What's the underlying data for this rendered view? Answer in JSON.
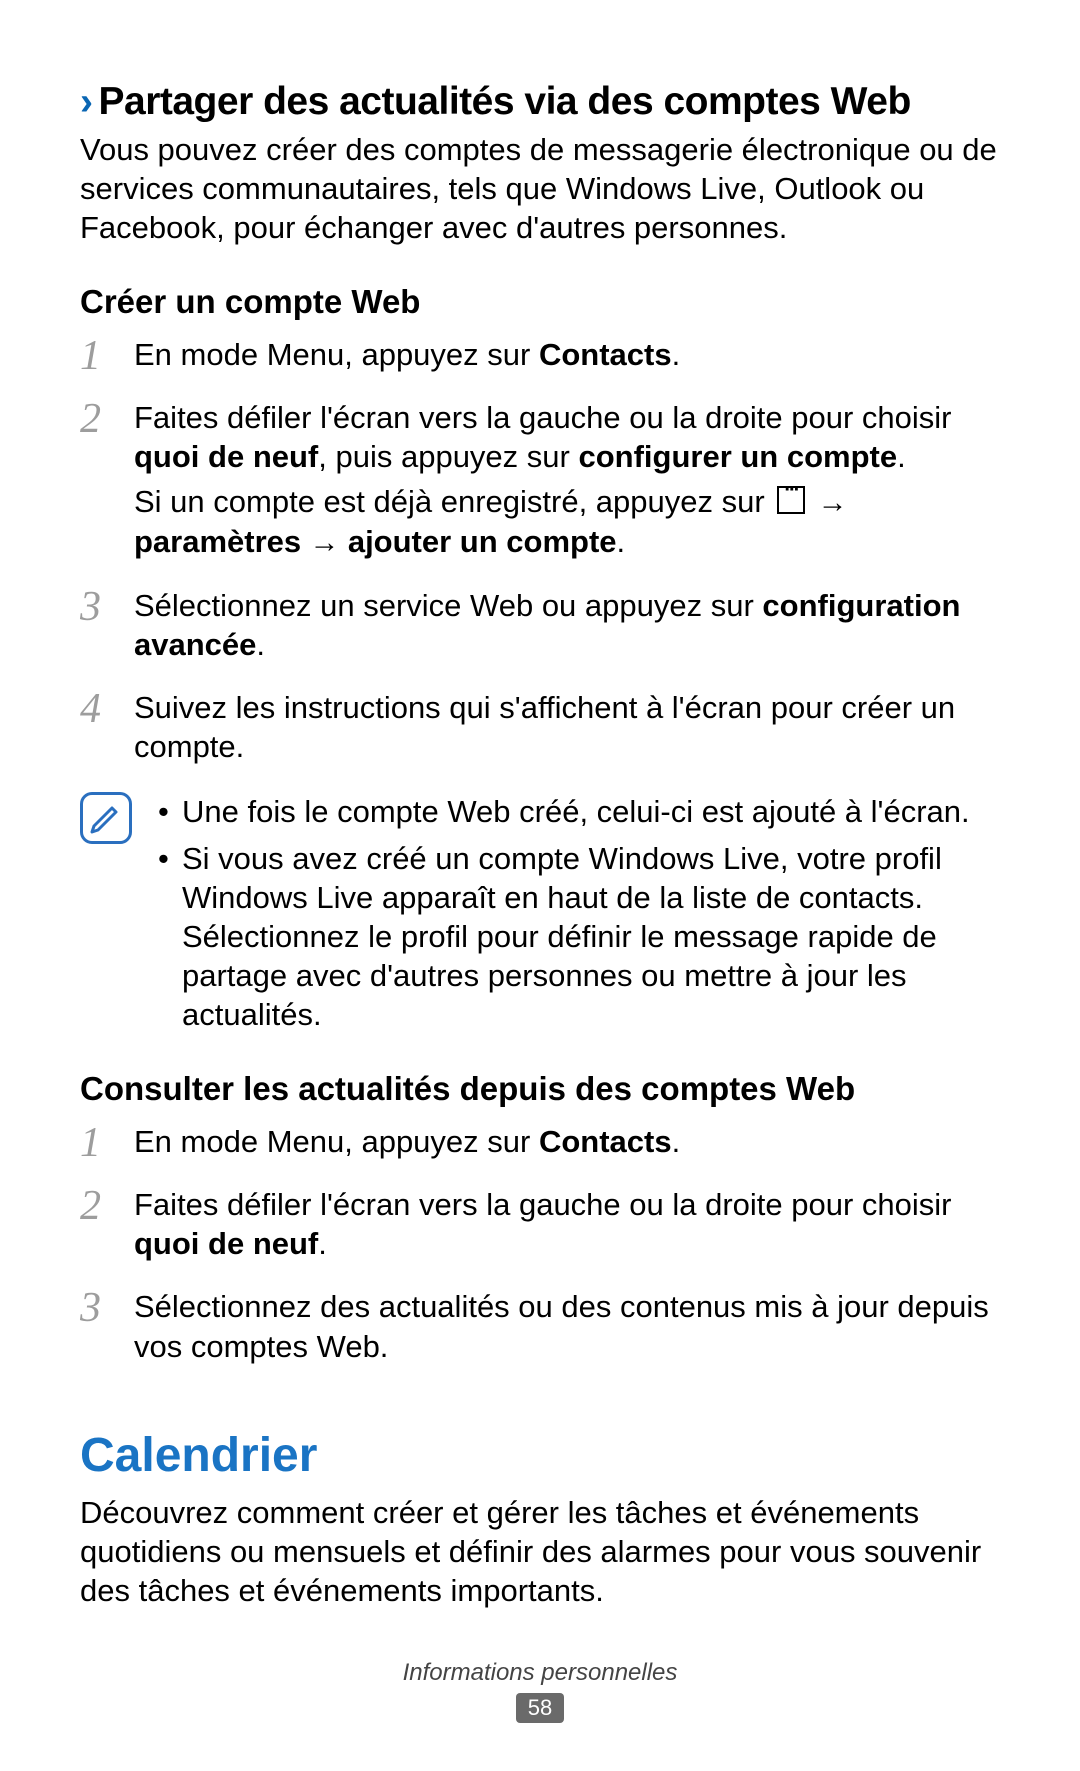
{
  "section1": {
    "title": "Partager des actualités via des comptes Web",
    "intro": "Vous pouvez créer des comptes de messagerie électronique ou de services communautaires, tels que Windows Live, Outlook ou Facebook, pour échanger avec d'autres personnes."
  },
  "sub1": {
    "heading": "Créer un compte Web",
    "step1_a": "En mode Menu, appuyez sur ",
    "step1_b": "Contacts",
    "step1_c": ".",
    "step2_a": "Faites défiler l'écran vers la gauche ou la droite pour choisir ",
    "step2_b": "quoi de neuf",
    "step2_c": ", puis appuyez sur ",
    "step2_d": "configurer un compte",
    "step2_e": ".",
    "step2_line2_a": "Si un compte est déjà enregistré, appuyez sur ",
    "step2_line2_arrow": " → ",
    "step2_line2_b": "paramètres",
    "step2_line2_arrow2": " → ",
    "step2_line2_c": "ajouter un compte",
    "step2_line2_d": ".",
    "step3_a": "Sélectionnez un service Web ou appuyez sur ",
    "step3_b": "configuration avancée",
    "step3_c": ".",
    "step4": "Suivez les instructions qui s'affichent à l'écran pour créer un compte."
  },
  "note": {
    "item1": "Une fois le compte Web créé, celui-ci est ajouté à l'écran.",
    "item2": "Si vous avez créé un compte Windows Live, votre profil Windows Live apparaît en haut de la liste de contacts. Sélectionnez le profil pour définir le message rapide de partage avec d'autres personnes ou mettre à jour les actualités."
  },
  "sub2": {
    "heading": "Consulter les actualités depuis des comptes Web",
    "step1_a": "En mode Menu, appuyez sur ",
    "step1_b": "Contacts",
    "step1_c": ".",
    "step2_a": "Faites défiler l'écran vers la gauche ou la droite pour choisir ",
    "step2_b": "quoi de neuf",
    "step2_c": ".",
    "step3": "Sélectionnez des actualités ou des contenus mis à jour depuis vos comptes Web."
  },
  "section2": {
    "title": "Calendrier",
    "intro": "Découvrez comment créer et gérer les tâches et événements quotidiens ou mensuels et définir des alarmes pour vous souvenir des tâches et événements importants."
  },
  "footer": {
    "label": "Informations personnelles",
    "page": "58"
  }
}
